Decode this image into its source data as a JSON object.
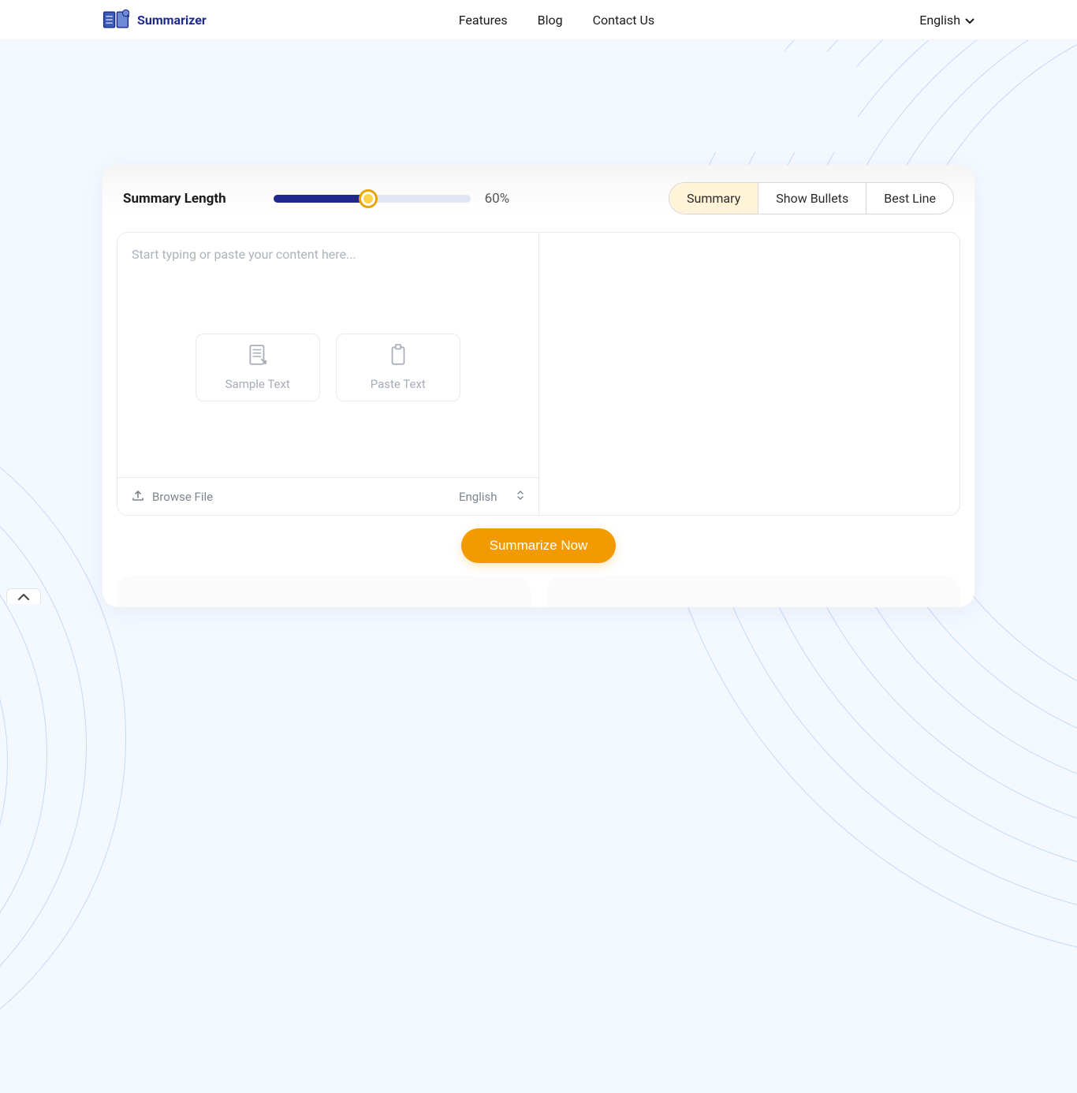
{
  "brand": {
    "name": "Summarizer"
  },
  "nav": {
    "features": "Features",
    "blog": "Blog",
    "contact": "Contact Us"
  },
  "header_lang": "English",
  "controls": {
    "label": "Summary Length",
    "percent": 60,
    "percent_display": "60%"
  },
  "modes": {
    "summary": "Summary",
    "bullets": "Show Bullets",
    "bestline": "Best Line"
  },
  "input": {
    "placeholder": "Start typing or paste your content here...",
    "sample_btn": "Sample Text",
    "paste_btn": "Paste Text"
  },
  "footer": {
    "browse": "Browse File",
    "lang": "English"
  },
  "cta": "Summarize Now"
}
